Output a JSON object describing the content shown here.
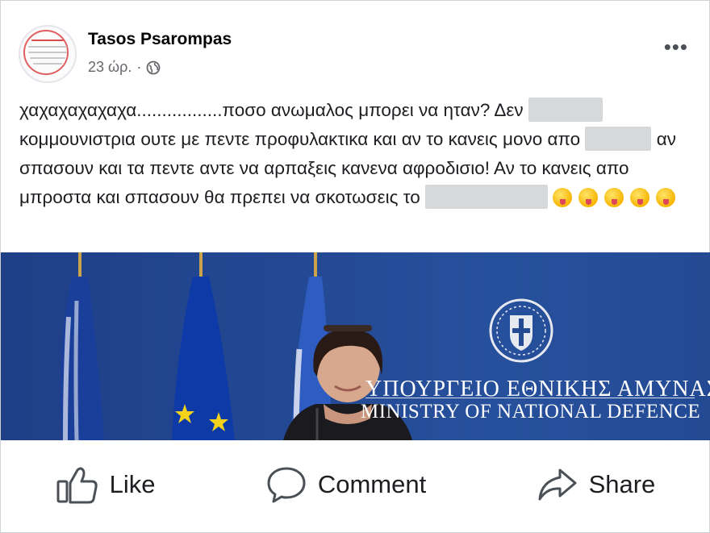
{
  "post": {
    "author": "Tasos Psarompas",
    "time": "23 ώρ.",
    "separator": "·",
    "text_parts": [
      "χαχαχαχαχαχα.................ποσο ανωμαλος μπορει να ηταν? Δεν ",
      " κομμουνιστρια ουτε με πεντε προφυλακτικα και αν το κανεις μονο απο ",
      " αν σπασουν και τα πεντε αντε να αρπαξεις κανενα αφροδισιο! Αν το κανεις απο μπροστα και σπασουν θα πρεπει να σκοτωσεις το "
    ],
    "emoji_count": 5
  },
  "photo": {
    "sign_greek": "ΥΠΟΥΡΓΕΙΟ ΕΘΝΙΚΗΣ ΑΜΥΝΑΣ",
    "sign_english": "MINISTRY OF NATIONAL DEFENCE"
  },
  "actions": {
    "like": "Like",
    "comment": "Comment",
    "share": "Share"
  },
  "icons": {
    "privacy": "globe-icon",
    "more": "more-options-icon",
    "like": "thumbs-up-icon",
    "comment": "speech-bubble-icon",
    "share": "share-arrow-icon"
  },
  "colors": {
    "author": "#050505",
    "meta": "#65676b",
    "photo_background": "#244a94"
  }
}
